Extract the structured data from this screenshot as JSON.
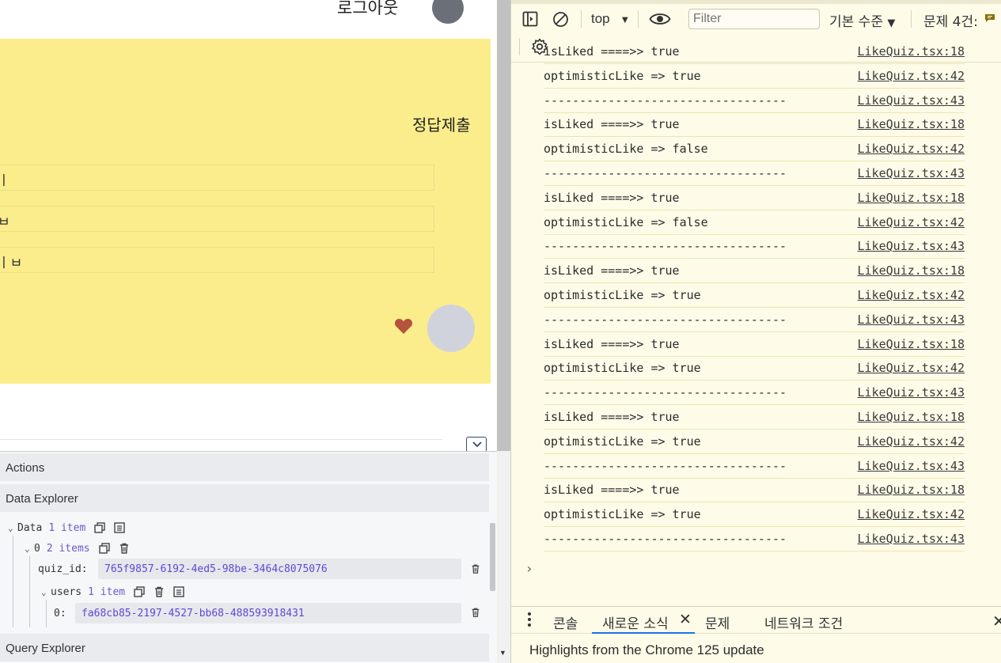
{
  "app": {
    "logout_label": "로그아웃",
    "submit_label": "정답제출",
    "options": [
      "ㅣ",
      "ㅂ",
      "ㅣㅂ"
    ]
  },
  "extension": {
    "actions_label": "Actions",
    "data_explorer_label": "Data Explorer",
    "query_explorer_label": "Query Explorer",
    "tree": {
      "data_key": "Data",
      "data_count": "1 item",
      "index0_key": "0",
      "index0_count": "2 items",
      "quiz_id_key": "quiz_id:",
      "quiz_id_value": "765f9857-6192-4ed5-98be-3464c8075076",
      "users_key": "users",
      "users_count": "1 item",
      "user0_key": "0:",
      "user0_value": "fa68cb85-2197-4527-bb68-488593918431"
    }
  },
  "devtools": {
    "context": "top",
    "filter_placeholder": "Filter",
    "level_label": "기본 수준",
    "issues_label": "문제 4건:",
    "console_rows": [
      {
        "msg": "isLiked ====>> true",
        "src": "LikeQuiz.tsx:18"
      },
      {
        "msg": "optimisticLike => true",
        "src": "LikeQuiz.tsx:42"
      },
      {
        "msg": "----------------------------------",
        "src": "LikeQuiz.tsx:43"
      },
      {
        "msg": "isLiked ====>> true",
        "src": "LikeQuiz.tsx:18"
      },
      {
        "msg": "optimisticLike => false",
        "src": "LikeQuiz.tsx:42"
      },
      {
        "msg": "----------------------------------",
        "src": "LikeQuiz.tsx:43"
      },
      {
        "msg": "isLiked ====>> true",
        "src": "LikeQuiz.tsx:18"
      },
      {
        "msg": "optimisticLike => false",
        "src": "LikeQuiz.tsx:42"
      },
      {
        "msg": "----------------------------------",
        "src": "LikeQuiz.tsx:43"
      },
      {
        "msg": "isLiked ====>> true",
        "src": "LikeQuiz.tsx:18"
      },
      {
        "msg": "optimisticLike => true",
        "src": "LikeQuiz.tsx:42"
      },
      {
        "msg": "----------------------------------",
        "src": "LikeQuiz.tsx:43"
      },
      {
        "msg": "isLiked ====>> true",
        "src": "LikeQuiz.tsx:18"
      },
      {
        "msg": "optimisticLike => true",
        "src": "LikeQuiz.tsx:42"
      },
      {
        "msg": "----------------------------------",
        "src": "LikeQuiz.tsx:43"
      },
      {
        "msg": "isLiked ====>> true",
        "src": "LikeQuiz.tsx:18"
      },
      {
        "msg": "optimisticLike => true",
        "src": "LikeQuiz.tsx:42"
      },
      {
        "msg": "----------------------------------",
        "src": "LikeQuiz.tsx:43"
      },
      {
        "msg": "isLiked ====>> true",
        "src": "LikeQuiz.tsx:18"
      },
      {
        "msg": "optimisticLike => true",
        "src": "LikeQuiz.tsx:42"
      },
      {
        "msg": "----------------------------------",
        "src": "LikeQuiz.tsx:43"
      }
    ],
    "prompt": "›",
    "drawer_tabs": {
      "console": "콘솔",
      "whats_new": "새로운 소식",
      "issues": "문제",
      "network_conditions": "네트워크 조건"
    },
    "close_glyph": "✕",
    "highlights": "Highlights from the Chrome 125 update"
  },
  "colors": {
    "card_yellow": "#fbed8c",
    "heart": "#b5533c",
    "devtools_bg": "#fffbe9",
    "tree_value": "#5b4ad6"
  }
}
